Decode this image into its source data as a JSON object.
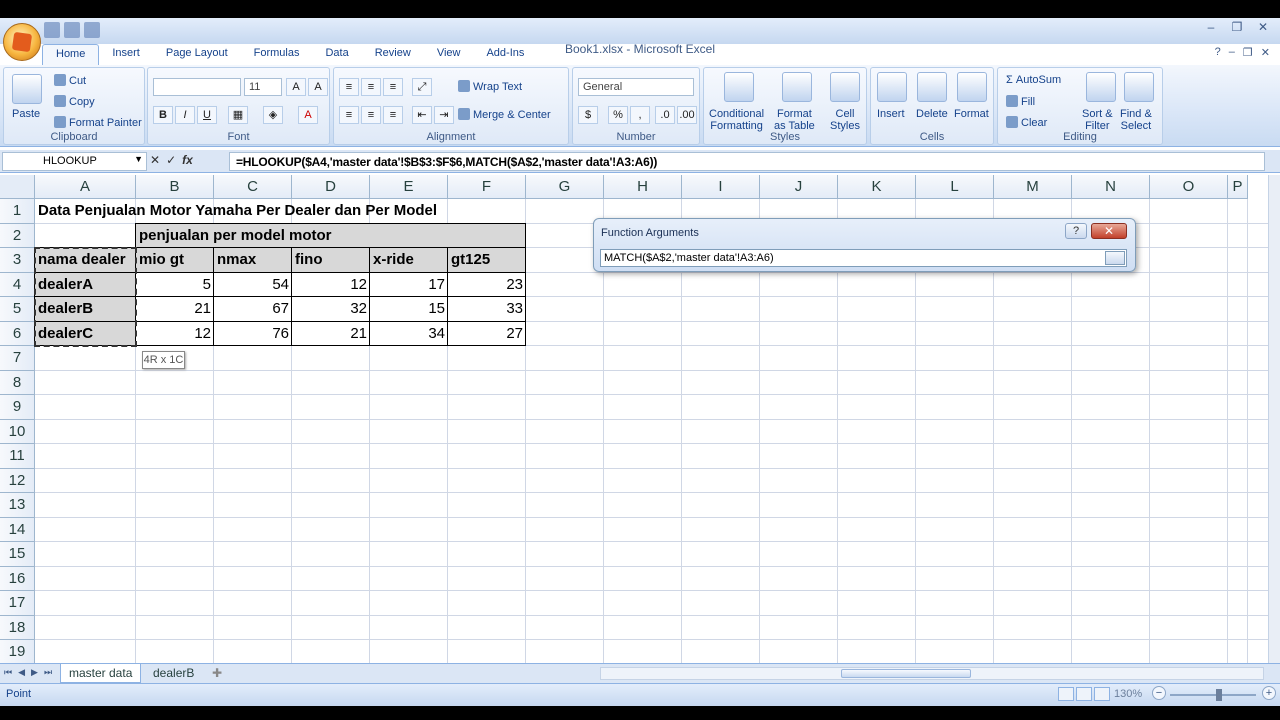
{
  "window": {
    "title": "Book1.xlsx - Microsoft Excel",
    "minimize": "–",
    "restore": "❐",
    "close": "✕"
  },
  "ribbon_tabs": [
    "Home",
    "Insert",
    "Page Layout",
    "Formulas",
    "Data",
    "Review",
    "View",
    "Add-Ins"
  ],
  "ribbon": {
    "clipboard": {
      "label": "Clipboard",
      "paste": "Paste",
      "cut": "Cut",
      "copy": "Copy",
      "format_painter": "Format Painter"
    },
    "font": {
      "label": "Font",
      "font_name": "",
      "font_size": "11",
      "bold": "B",
      "italic": "I",
      "underline": "U"
    },
    "alignment": {
      "label": "Alignment",
      "wrap_text": "Wrap Text",
      "merge_center": "Merge & Center"
    },
    "number": {
      "label": "Number",
      "format": "General",
      "currency": "$",
      "percent": "%",
      "comma": ","
    },
    "styles": {
      "label": "Styles",
      "conditional_formatting": [
        "Conditional",
        "Formatting"
      ],
      "format_as_table": [
        "Format",
        "as Table"
      ],
      "cell_styles": [
        "Cell",
        "Styles"
      ]
    },
    "cells": {
      "label": "Cells",
      "insert": "Insert",
      "delete": "Delete",
      "format": "Format"
    },
    "editing": {
      "label": "Editing",
      "autosum": "AutoSum",
      "fill": "Fill",
      "clear": "Clear",
      "sort_filter": [
        "Sort &",
        "Filter"
      ],
      "find_select": [
        "Find &",
        "Select"
      ]
    }
  },
  "formula_bar": {
    "name_box": "HLOOKUP",
    "fx": "fx",
    "formula": "=HLOOKUP($A4,'master data'!$B$3:$F$6,MATCH($A$2,'master data'!A3:A6))"
  },
  "columns": [
    "A",
    "B",
    "C",
    "D",
    "E",
    "F",
    "G",
    "H",
    "I",
    "J",
    "K",
    "L",
    "M",
    "N",
    "O",
    "P"
  ],
  "rows": [
    "1",
    "2",
    "3",
    "4",
    "5",
    "6",
    "7",
    "8",
    "9",
    "10",
    "11",
    "12",
    "13",
    "14",
    "15",
    "16",
    "17",
    "18",
    "19"
  ],
  "sheet": {
    "title": "Data Penjualan Motor Yamaha Per Dealer dan Per Model",
    "group_header": "penjualan per model motor",
    "header_row": [
      "nama dealer",
      "mio gt",
      "nmax",
      "fino",
      "x-ride",
      "gt125"
    ],
    "data_rows": [
      [
        "dealerA",
        "5",
        "54",
        "12",
        "17",
        "23"
      ],
      [
        "dealerB",
        "21",
        "67",
        "32",
        "15",
        "33"
      ],
      [
        "dealerC",
        "12",
        "76",
        "21",
        "34",
        "27"
      ]
    ]
  },
  "tooltip": "4R x 1C",
  "dialog": {
    "title": "Function Arguments",
    "help": "?",
    "close": "✕",
    "input": "MATCH($A$2,'master data'!A3:A6)"
  },
  "sheet_tabs": [
    "master data",
    "dealerB"
  ],
  "status": {
    "mode": "Point",
    "zoom": "130%"
  }
}
